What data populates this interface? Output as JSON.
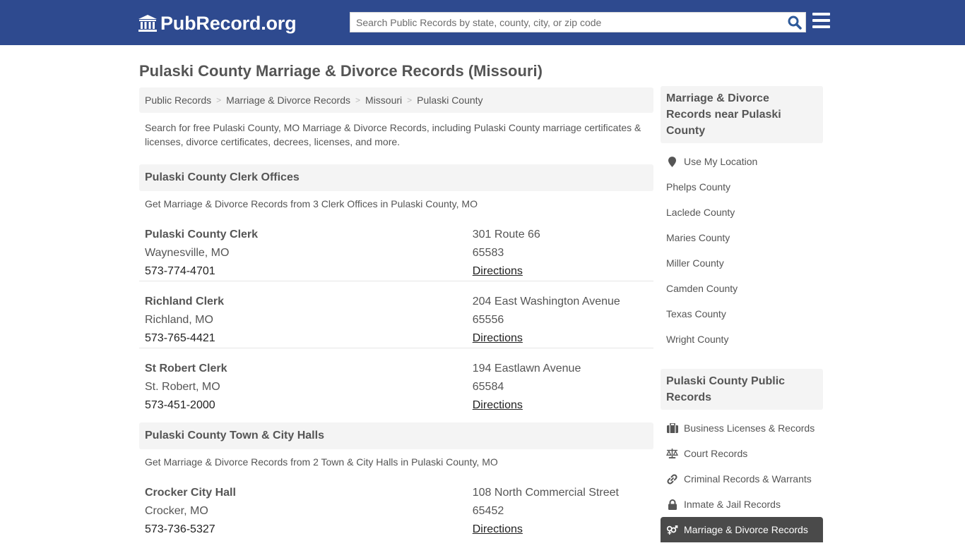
{
  "header": {
    "logo_text": "PubRecord.org",
    "search_placeholder": "Search Public Records by state, county, city, or zip code",
    "search_value": ""
  },
  "page_title": "Pulaski County Marriage & Divorce Records (Missouri)",
  "breadcrumb": [
    "Public Records",
    "Marriage & Divorce Records",
    "Missouri",
    "Pulaski County"
  ],
  "intro": "Search for free Pulaski County, MO Marriage & Divorce Records, including Pulaski County marriage certificates & licenses, divorce certificates, decrees, licenses, and more.",
  "sections": [
    {
      "title": "Pulaski County Clerk Offices",
      "description": "Get Marriage & Divorce Records from 3 Clerk Offices in Pulaski County, MO",
      "offices": [
        {
          "name": "Pulaski County Clerk",
          "city": "Waynesville, MO",
          "phone": "573-774-4701",
          "address": "301 Route 66",
          "zip": "65583",
          "directions": "Directions"
        },
        {
          "name": "Richland Clerk",
          "city": "Richland, MO",
          "phone": "573-765-4421",
          "address": "204 East Washington Avenue",
          "zip": "65556",
          "directions": "Directions"
        },
        {
          "name": "St Robert Clerk",
          "city": "St. Robert, MO",
          "phone": "573-451-2000",
          "address": "194 Eastlawn Avenue",
          "zip": "65584",
          "directions": "Directions"
        }
      ]
    },
    {
      "title": "Pulaski County Town & City Halls",
      "description": "Get Marriage & Divorce Records from 2 Town & City Halls in Pulaski County, MO",
      "offices": [
        {
          "name": "Crocker City Hall",
          "city": "Crocker, MO",
          "phone": "573-736-5327",
          "address": "108 North Commercial Street",
          "zip": "65452",
          "directions": "Directions"
        }
      ]
    }
  ],
  "sidebar": {
    "nearby": {
      "title": "Marriage & Divorce Records near Pulaski County",
      "use_location": "Use My Location",
      "counties": [
        "Phelps County",
        "Laclede County",
        "Maries County",
        "Miller County",
        "Camden County",
        "Texas County",
        "Wright County"
      ]
    },
    "public_records": {
      "title": "Pulaski County Public Records",
      "items": [
        {
          "label": "Business Licenses & Records",
          "icon": "briefcase-icon"
        },
        {
          "label": "Court Records",
          "icon": "scales-icon"
        },
        {
          "label": "Criminal Records & Warrants",
          "icon": "link-icon"
        },
        {
          "label": "Inmate & Jail Records",
          "icon": "lock-icon"
        },
        {
          "label": "Marriage & Divorce Records",
          "icon": "gender-icon",
          "active": true
        }
      ]
    }
  }
}
